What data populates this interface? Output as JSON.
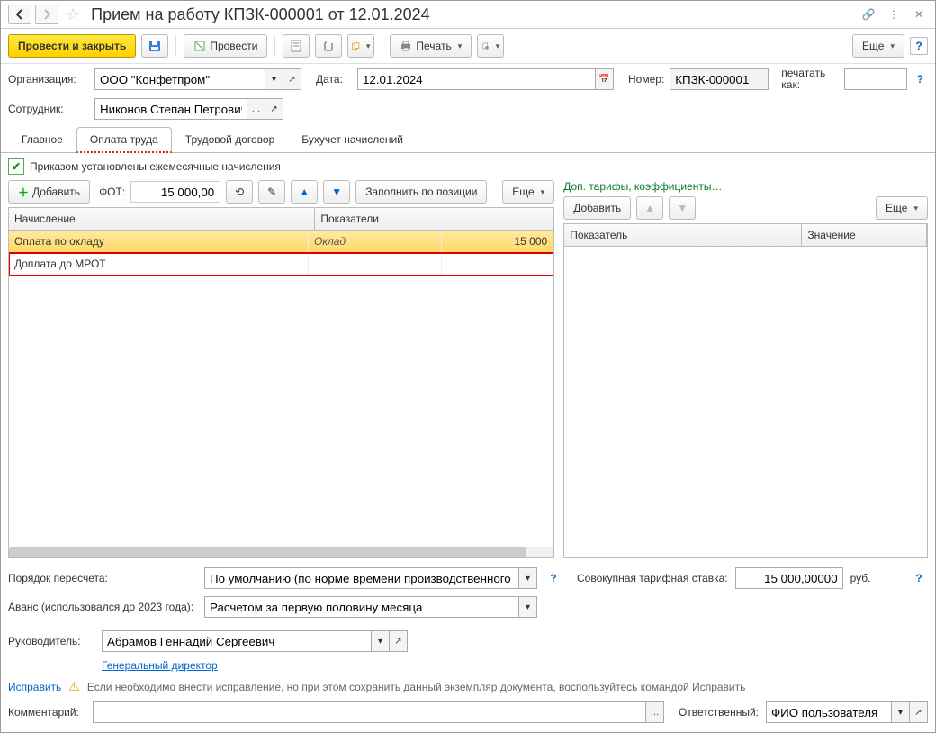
{
  "title": "Прием на работу КПЗК-000001 от 12.01.2024",
  "toolbar": {
    "submit_close": "Провести и закрыть",
    "submit": "Провести",
    "print": "Печать",
    "more": "Еще"
  },
  "form": {
    "org_label": "Организация:",
    "org_value": "ООО \"Конфетпром\"",
    "date_label": "Дата:",
    "date_value": "12.01.2024",
    "number_label": "Номер:",
    "number_value": "КПЗК-000001",
    "print_as_label": "печатать как:",
    "employee_label": "Сотрудник:",
    "employee_value": "Никонов Степан Петрович"
  },
  "tabs": [
    "Главное",
    "Оплата труда",
    "Трудовой договор",
    "Бухучет начислений"
  ],
  "checkbox_label": "Приказом установлены ежемесячные начисления",
  "left_panel": {
    "add": "Добавить",
    "fot_label": "ФОТ:",
    "fot_value": "15 000,00",
    "fill_by_position": "Заполнить по позиции",
    "more": "Еще",
    "cols": [
      "Начисление",
      "Показатели"
    ],
    "rows": [
      {
        "name": "Оплата по окладу",
        "indicator": "Оклад",
        "value": "15 000"
      },
      {
        "name": "Доплата до МРОТ",
        "indicator": "",
        "value": ""
      }
    ]
  },
  "right_panel": {
    "tariffs_link": "Доп. тарифы, коэффициенты…",
    "add": "Добавить",
    "more": "Еще",
    "cols": [
      "Показатель",
      "Значение"
    ]
  },
  "footer": {
    "recalc_label": "Порядок пересчета:",
    "recalc_value": "По умолчанию (по норме времени производственного календ",
    "rate_label": "Совокупная тарифная ставка:",
    "rate_value": "15 000,00000",
    "rate_unit": "руб.",
    "advance_label": "Аванс (использовался до 2023 года):",
    "advance_value": "Расчетом за первую половину месяца",
    "manager_label": "Руководитель:",
    "manager_value": "Абрамов Геннадий Сергеевич",
    "manager_position": "Генеральный директор",
    "fix_link": "Исправить",
    "fix_note": "Если необходимо внести исправление, но при этом сохранить данный экземпляр документа, воспользуйтесь командой Исправить",
    "comment_label": "Комментарий:",
    "responsible_label": "Ответственный:",
    "responsible_value": "ФИО пользователя"
  }
}
